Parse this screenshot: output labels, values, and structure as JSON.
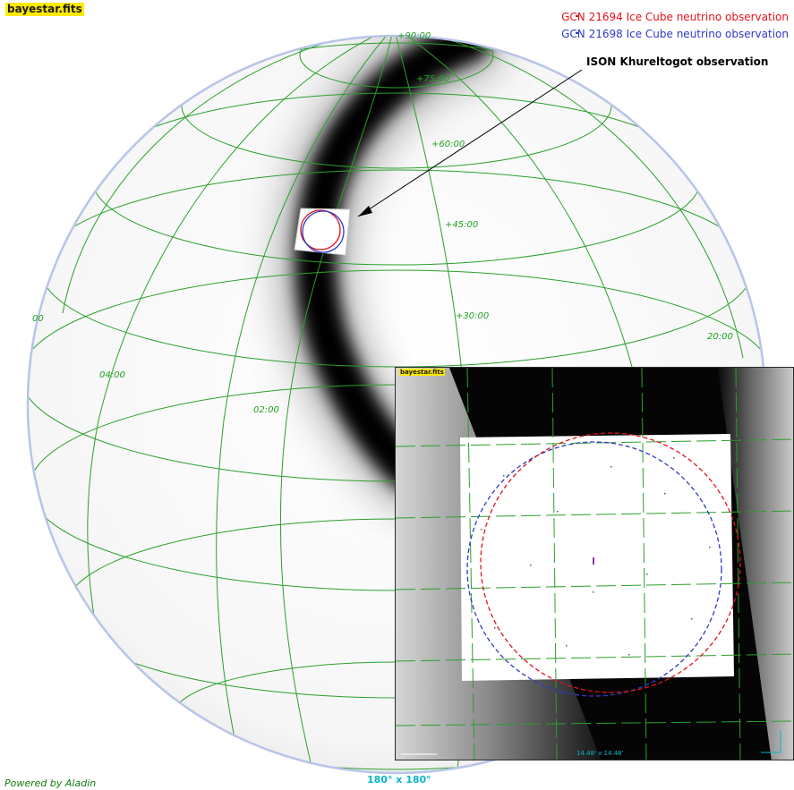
{
  "window": {
    "title": "bayestar.fits",
    "footer_left": "Powered by Aladin",
    "footer_center": "180° x 180°"
  },
  "legend": {
    "red_label": "GCN 21694 Ice Cube neutrino observation",
    "blue_label": "GCN 21698 Ice Cube neutrino observation"
  },
  "annotation": {
    "label": "ISON Khureltogot observation"
  },
  "grid_labels": {
    "dec_90": "+90:00",
    "dec_75": "+75:00",
    "dec_60": "+60:00",
    "dec_45": "+45:00",
    "dec_30": "+30:00",
    "ra_04": "04:00",
    "ra_02": "02:00",
    "ra_20": "20:00",
    "left_partial": "00"
  },
  "inset": {
    "title": "bayestar.fits",
    "footer": "14.48' x 14.48'"
  },
  "colors": {
    "grid": "#2aa02a",
    "red_circle": "#e4121b",
    "blue_circle": "#2d3ac8",
    "title_bg": "#ffea00",
    "sphere_edge": "#b8c4e8",
    "footer_cyan": "#0ab5c9"
  }
}
